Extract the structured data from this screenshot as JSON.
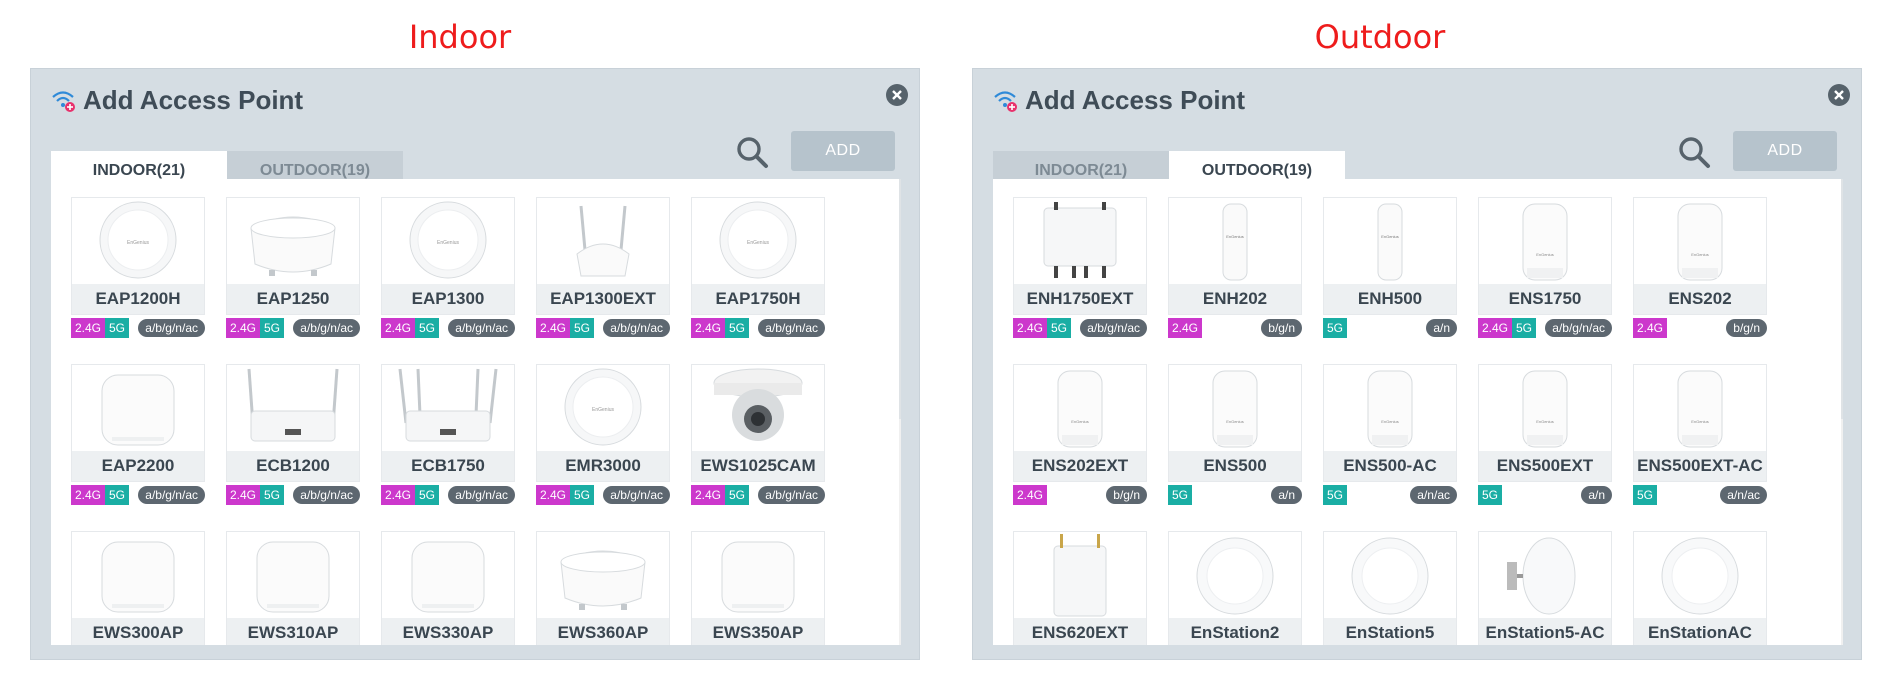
{
  "colors": {
    "badge_24g": "#cc38cc",
    "badge_5g": "#1aaea4",
    "badge_std": "#5d6770",
    "title_red": "#ee1c1c",
    "dialog_bg": "#d5dde3"
  },
  "panels": [
    {
      "label": "Indoor",
      "dialog_title": "Add Access Point",
      "add_label": "ADD",
      "active_tab": 0,
      "tabs": [
        "INDOOR(21)",
        "OUTDOOR(19)"
      ],
      "items": [
        {
          "name": "EAP1200H",
          "shape": "dome",
          "bands": [
            "2.4G",
            "5G"
          ],
          "std": "a/b/g/n/ac"
        },
        {
          "name": "EAP1250",
          "shape": "ufo",
          "bands": [
            "2.4G",
            "5G"
          ],
          "std": "a/b/g/n/ac"
        },
        {
          "name": "EAP1300",
          "shape": "dome",
          "bands": [
            "2.4G",
            "5G"
          ],
          "std": "a/b/g/n/ac"
        },
        {
          "name": "EAP1300EXT",
          "shape": "antenna2",
          "bands": [
            "2.4G",
            "5G"
          ],
          "std": "a/b/g/n/ac"
        },
        {
          "name": "EAP1750H",
          "shape": "dome",
          "bands": [
            "2.4G",
            "5G"
          ],
          "std": "a/b/g/n/ac"
        },
        {
          "name": "EAP2200",
          "shape": "square",
          "bands": [
            "2.4G",
            "5G"
          ],
          "std": "a/b/g/n/ac"
        },
        {
          "name": "ECB1200",
          "shape": "router",
          "bands": [
            "2.4G",
            "5G"
          ],
          "std": "a/b/g/n/ac"
        },
        {
          "name": "ECB1750",
          "shape": "router4",
          "bands": [
            "2.4G",
            "5G"
          ],
          "std": "a/b/g/n/ac"
        },
        {
          "name": "EMR3000",
          "shape": "dome",
          "bands": [
            "2.4G",
            "5G"
          ],
          "std": "a/b/g/n/ac"
        },
        {
          "name": "EWS1025CAM",
          "shape": "camera",
          "bands": [
            "2.4G",
            "5G"
          ],
          "std": "a/b/g/n/ac"
        },
        {
          "name": "EWS300AP",
          "shape": "square",
          "bands": [],
          "std": ""
        },
        {
          "name": "EWS310AP",
          "shape": "square",
          "bands": [],
          "std": ""
        },
        {
          "name": "EWS330AP",
          "shape": "square",
          "bands": [],
          "std": ""
        },
        {
          "name": "EWS360AP",
          "shape": "ufo",
          "bands": [],
          "std": ""
        },
        {
          "name": "EWS350AP",
          "shape": "square",
          "bands": [],
          "std": ""
        }
      ]
    },
    {
      "label": "Outdoor",
      "dialog_title": "Add Access Point",
      "add_label": "ADD",
      "active_tab": 1,
      "tabs": [
        "INDOOR(21)",
        "OUTDOOR(19)"
      ],
      "items": [
        {
          "name": "ENH1750EXT",
          "shape": "box4",
          "bands": [
            "2.4G",
            "5G"
          ],
          "std": "a/b/g/n/ac"
        },
        {
          "name": "ENH202",
          "shape": "slim",
          "bands": [
            "2.4G"
          ],
          "std": "b/g/n"
        },
        {
          "name": "ENH500",
          "shape": "slim",
          "bands": [
            "5G"
          ],
          "std": "a/n"
        },
        {
          "name": "ENS1750",
          "shape": "tower",
          "bands": [
            "2.4G",
            "5G"
          ],
          "std": "a/b/g/n/ac"
        },
        {
          "name": "ENS202",
          "shape": "tower",
          "bands": [
            "2.4G"
          ],
          "std": "b/g/n"
        },
        {
          "name": "ENS202EXT",
          "shape": "tower",
          "bands": [
            "2.4G"
          ],
          "std": "b/g/n"
        },
        {
          "name": "ENS500",
          "shape": "tower",
          "bands": [
            "5G"
          ],
          "std": "a/n"
        },
        {
          "name": "ENS500-AC",
          "shape": "tower",
          "bands": [
            "5G"
          ],
          "std": "a/n/ac"
        },
        {
          "name": "ENS500EXT",
          "shape": "tower",
          "bands": [
            "5G"
          ],
          "std": "a/n"
        },
        {
          "name": "ENS500EXT-AC",
          "shape": "tower",
          "bands": [
            "5G"
          ],
          "std": "a/n/ac"
        },
        {
          "name": "ENS620EXT",
          "shape": "box2",
          "bands": [],
          "std": ""
        },
        {
          "name": "EnStation2",
          "shape": "dish",
          "bands": [],
          "std": ""
        },
        {
          "name": "EnStation5",
          "shape": "dish",
          "bands": [],
          "std": ""
        },
        {
          "name": "EnStation5-AC",
          "shape": "dishside",
          "bands": [],
          "std": ""
        },
        {
          "name": "EnStationAC",
          "shape": "dish",
          "bands": [],
          "std": ""
        }
      ]
    }
  ]
}
